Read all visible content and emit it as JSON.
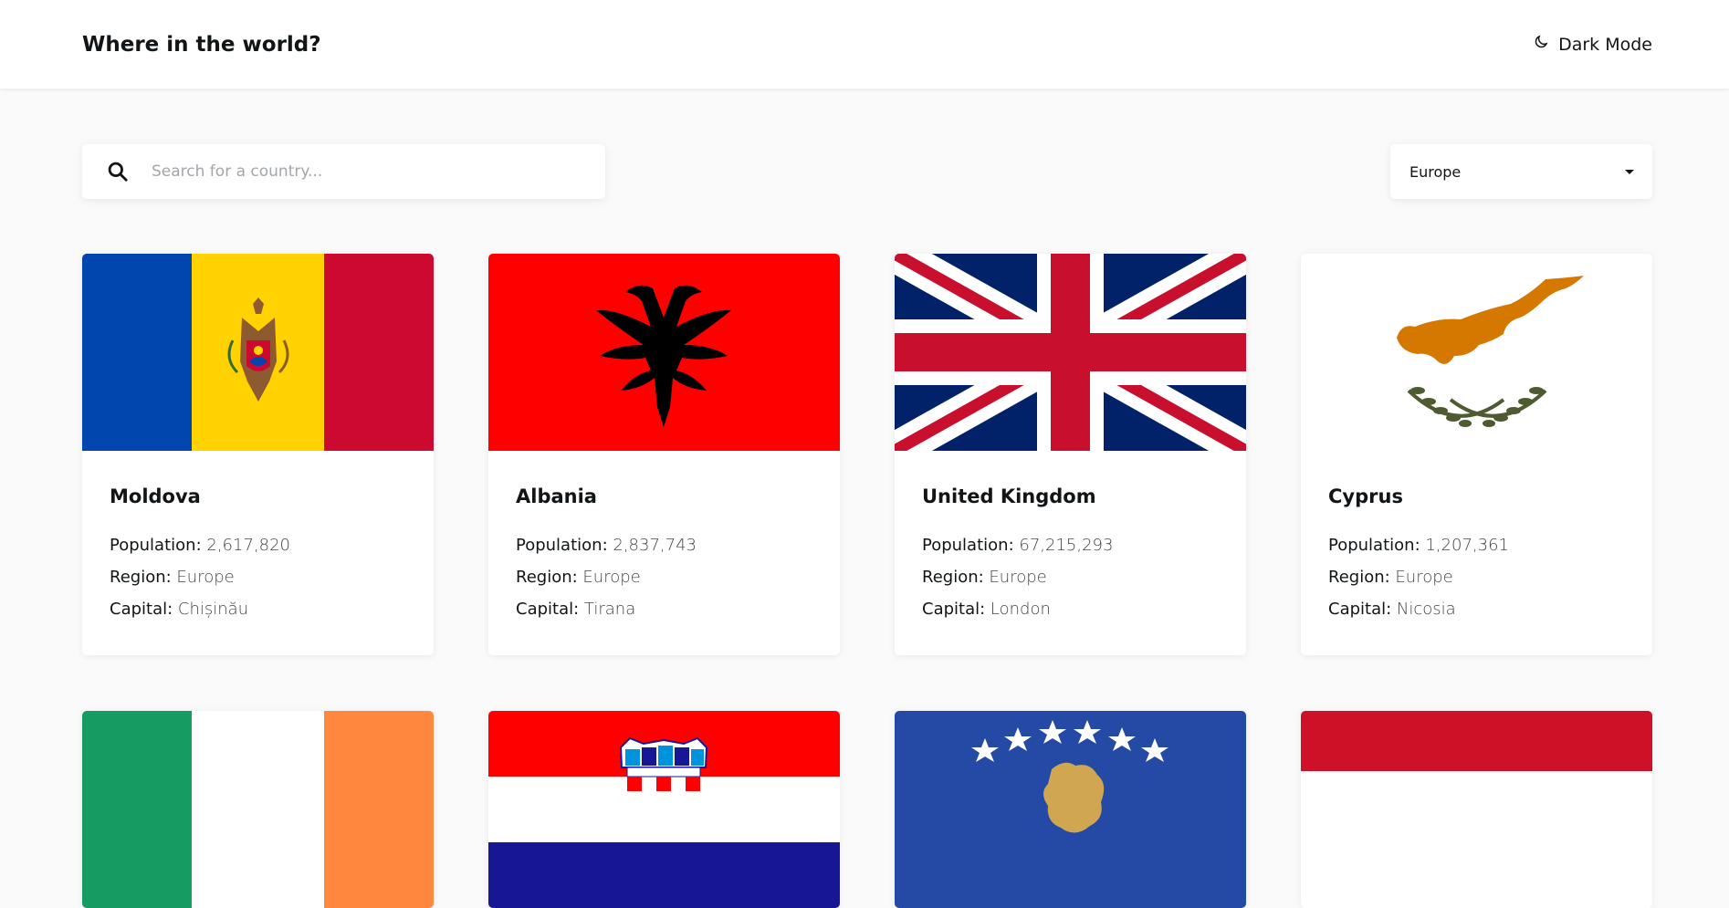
{
  "header": {
    "title": "Where in the world?",
    "mode_label": "Dark Mode"
  },
  "search": {
    "placeholder": "Search for a country...",
    "value": ""
  },
  "filter": {
    "selected": "Europe"
  },
  "labels": {
    "population": "Population:",
    "region": "Region:",
    "capital": "Capital:"
  },
  "countries": [
    {
      "name": "Moldova",
      "population": "2,617,820",
      "region": "Europe",
      "capital": "Chișinău",
      "flag": "moldova-flag"
    },
    {
      "name": "Albania",
      "population": "2,837,743",
      "region": "Europe",
      "capital": "Tirana",
      "flag": "albania-flag"
    },
    {
      "name": "United Kingdom",
      "population": "67,215,293",
      "region": "Europe",
      "capital": "London",
      "flag": "united-kingdom-flag"
    },
    {
      "name": "Cyprus",
      "population": "1,207,361",
      "region": "Europe",
      "capital": "Nicosia",
      "flag": "cyprus-flag"
    },
    {
      "name": "",
      "flag": "ireland-flag"
    },
    {
      "name": "",
      "flag": "croatia-flag"
    },
    {
      "name": "",
      "flag": "kosovo-flag"
    },
    {
      "name": "",
      "flag": "monaco-flag"
    }
  ],
  "colors": {
    "background": "#fafafa",
    "card": "#ffffff",
    "text": "#111517"
  }
}
